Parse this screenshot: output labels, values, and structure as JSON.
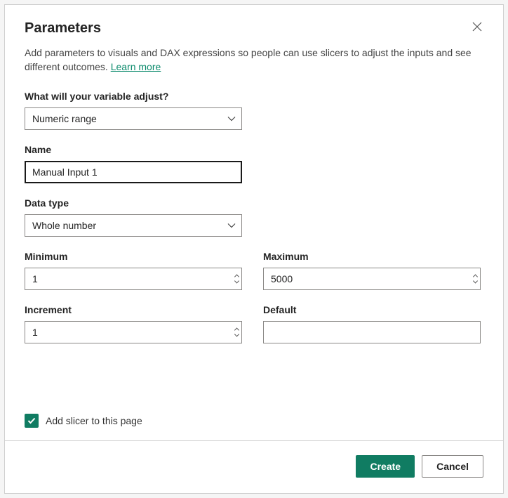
{
  "title": "Parameters",
  "description": "Add parameters to visuals and DAX expressions so people can use slicers to adjust the inputs and see different outcomes. ",
  "learn_more": "Learn more",
  "fields": {
    "variable_adjust": {
      "label": "What will your variable adjust?",
      "value": "Numeric range"
    },
    "name": {
      "label": "Name",
      "value": "Manual Input 1"
    },
    "data_type": {
      "label": "Data type",
      "value": "Whole number"
    },
    "minimum": {
      "label": "Minimum",
      "value": "1"
    },
    "maximum": {
      "label": "Maximum",
      "value": "5000"
    },
    "increment": {
      "label": "Increment",
      "value": "1"
    },
    "default": {
      "label": "Default",
      "value": ""
    }
  },
  "checkbox": {
    "label": "Add slicer to this page",
    "checked": true
  },
  "buttons": {
    "create": "Create",
    "cancel": "Cancel"
  }
}
